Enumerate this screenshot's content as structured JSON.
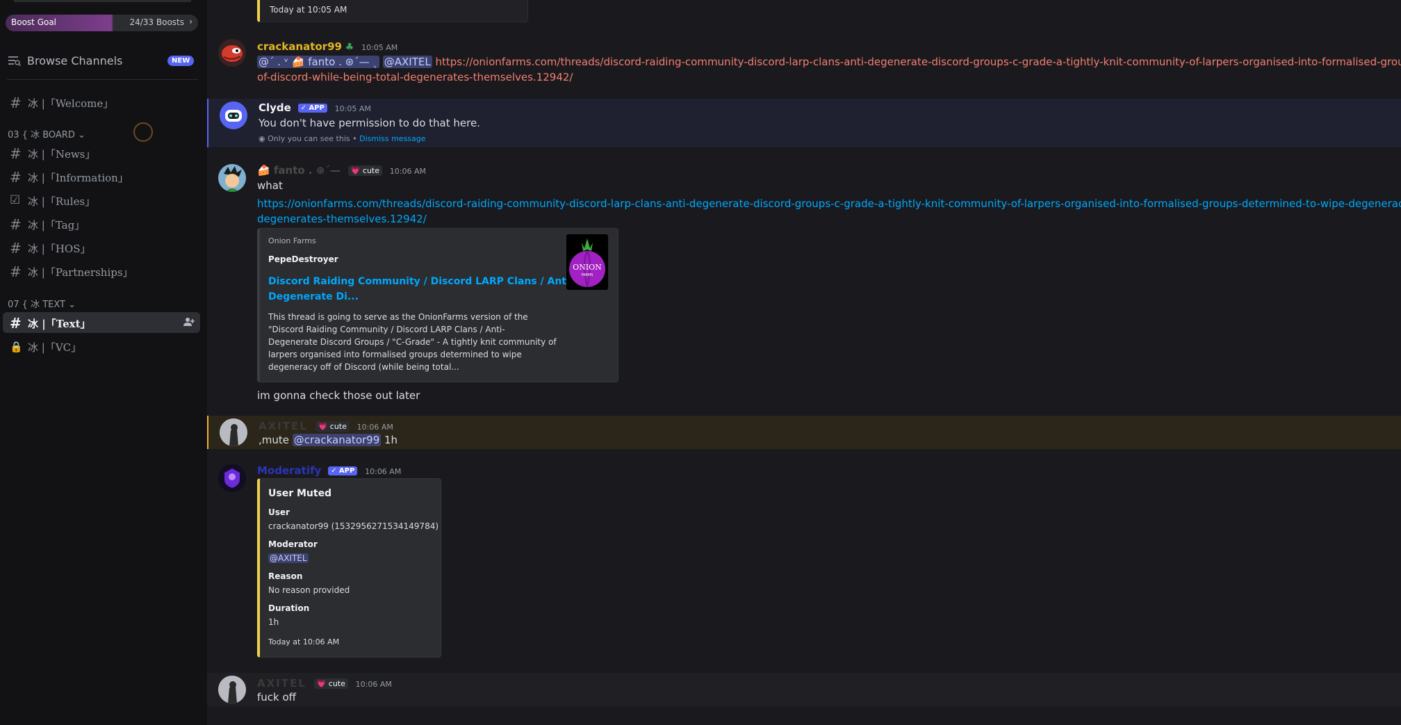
{
  "sidebar": {
    "boost": {
      "label": "Boost Goal",
      "count": "24/33 Boosts",
      "chevron": "›"
    },
    "browse": {
      "label": "Browse Channels",
      "badge": "NEW"
    },
    "welcome": {
      "icon": "#",
      "label": "冰 |「Welcome」"
    },
    "cat_board": "03 { 冰 BOARD ⌄",
    "board_channels": [
      {
        "icon": "#",
        "label": "冰 |「News」"
      },
      {
        "icon": "#",
        "label": "冰 |「Information」"
      },
      {
        "icon": "☑",
        "label": "冰 |「Rules」"
      },
      {
        "icon": "#",
        "label": "冰 |「Tag」"
      },
      {
        "icon": "#",
        "label": "冰 |「HOS」"
      },
      {
        "icon": "#",
        "label": "冰 |「Partnerships」"
      }
    ],
    "cat_text": "07 { 冰 TEXT ⌄",
    "text_channels": [
      {
        "icon": "#",
        "label": "冰 |「Text」",
        "active": true
      },
      {
        "icon": "🔒",
        "label": "冰 |「VC」"
      }
    ]
  },
  "colors": {
    "accent": "#5865f2",
    "link": "#00a8fc",
    "warn_border": "#f0d24a"
  },
  "messages": {
    "prev_embed_ts": "Today at 10:05 AM",
    "m1": {
      "username": "crackanator99",
      "time": "10:05 AM",
      "mention_prefix": "@ˊ . ᵛ 🍰 fanto . ⊛ˊ— ˎ",
      "mention": "@AXITEL",
      "link1": "https://onionfarms.com/threads/discord-raiding-community-discord-larp-clans-anti-degenerate-discord-groups-c-grade-a-tightly-knit-community-of-larpers-organised-into-formalised-groups-determined-t",
      "link2": "of-discord-while-being-total-degenerates-themselves.12942/"
    },
    "m2": {
      "username": "Clyde",
      "app": "✓ APP",
      "time": "10:05 AM",
      "text": "You don't have permission to do that here.",
      "note": "Only you can see this • ",
      "dismiss": "Dismiss message"
    },
    "m3": {
      "username": "🍰 fanto . ⊛ˊ—",
      "badge": "💗 cute",
      "time": "10:06 AM",
      "text": "what",
      "link1": "https://onionfarms.com/threads/discord-raiding-community-discord-larp-clans-anti-degenerate-discord-groups-c-grade-a-tightly-knit-community-of-larpers-organised-into-formalised-groups-determined-to-wipe-degeneracy-off-of-discor",
      "link2": "degenerates-themselves.12942/",
      "embed": {
        "provider": "Onion Farms",
        "author": "PepeDestroyer",
        "title1": "Discord Raiding Community / Discord LARP Clans / Anti-",
        "title2": "Degenerate Di...",
        "desc1": "This thread is going to serve as the OnionFarms version of the",
        "desc2": "\"Discord Raiding Community / Discord LARP Clans / Anti-",
        "desc3": "Degenerate Discord Groups / \"C-Grade\" - A tightly knit community of",
        "desc4": "larpers organised into formalised groups determined to wipe",
        "desc5": "degeneracy off of Discord (while being total...",
        "thumb_text": "ONION",
        "thumb_sub": "FARMS"
      },
      "text2": "im gonna check those out later"
    },
    "m4": {
      "username": "AXITEL",
      "badge": "💗 cute",
      "time": "10:06 AM",
      "text_a": ",mute ",
      "mention": "@crackanator99",
      "text_b": " 1h"
    },
    "m5": {
      "username": "Moderatify",
      "app": "✓ APP",
      "time": "10:06 AM",
      "avatar_text": "Moderatify",
      "embed": {
        "title": "User Muted",
        "f1_name": "User",
        "f1_value": "crackanator99 (1532956271534149784)",
        "f2_name": "Moderator",
        "f2_value": "@AXITEL",
        "f3_name": "Reason",
        "f3_value": "No reason provided",
        "f4_name": "Duration",
        "f4_value": "1h",
        "footer": "Today at 10:06 AM"
      }
    },
    "m6": {
      "username": "AXITEL",
      "badge": "💗 cute",
      "time": "10:06 AM",
      "text": "fuck off"
    }
  }
}
